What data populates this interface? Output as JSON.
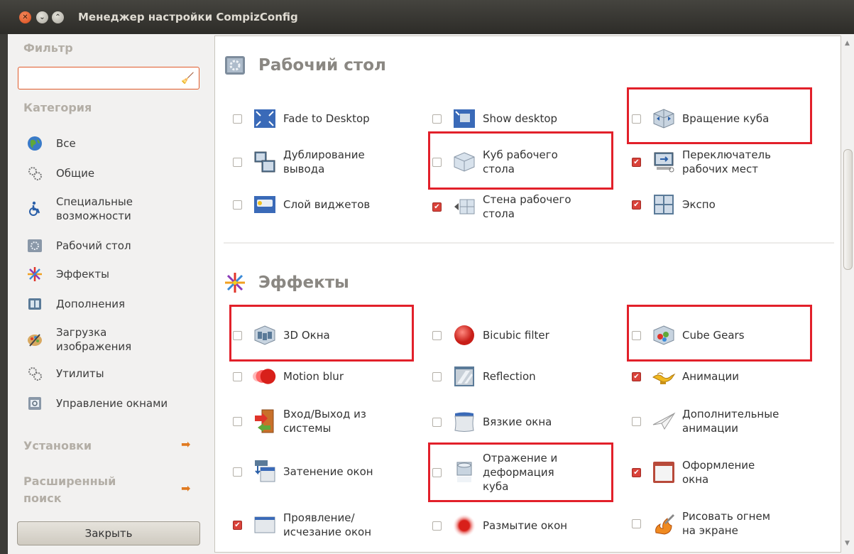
{
  "window": {
    "title": "Менеджер настройки CompizConfig"
  },
  "sidebar": {
    "filter_heading": "Фильтр",
    "filter_value": "",
    "category_heading": "Категория",
    "categories": [
      {
        "label": "Все",
        "icon": "globe-icon"
      },
      {
        "label": "Общие",
        "icon": "gears-icon"
      },
      {
        "label": "Специальные\nвозможности",
        "icon": "accessibility-icon"
      },
      {
        "label": "Рабочий стол",
        "icon": "desktop-icon"
      },
      {
        "label": "Эффекты",
        "icon": "effects-icon"
      },
      {
        "label": "Дополнения",
        "icon": "extras-icon"
      },
      {
        "label": "Загрузка\nизображения",
        "icon": "image-loading-icon"
      },
      {
        "label": "Утилиты",
        "icon": "utilities-icon"
      },
      {
        "label": "Управление окнами",
        "icon": "window-management-icon"
      }
    ],
    "settings_label": "Установки",
    "advanced_search_label": "Расширенный\nпоиск",
    "close_button": "Закрыть"
  },
  "sections": {
    "desktop": {
      "title": "Рабочий стол",
      "items": [
        {
          "label": "Fade to Desktop",
          "checked": false
        },
        {
          "label": "Show desktop",
          "checked": false
        },
        {
          "label": "Вращение куба",
          "checked": false
        },
        {
          "label": "Дублирование\nвывода",
          "checked": false
        },
        {
          "label": "Куб рабочего\nстола",
          "checked": false
        },
        {
          "label": "Переключатель\nрабочих мест",
          "checked": true
        },
        {
          "label": "Слой виджетов",
          "checked": false
        },
        {
          "label": "Стена рабочего\nстола",
          "checked": true
        },
        {
          "label": "Экспо",
          "checked": true
        }
      ]
    },
    "effects": {
      "title": "Эффекты",
      "items": [
        {
          "label": "3D Окна",
          "checked": false
        },
        {
          "label": "Bicubic filter",
          "checked": false
        },
        {
          "label": "Cube Gears",
          "checked": false
        },
        {
          "label": "Motion blur",
          "checked": false
        },
        {
          "label": "Reflection",
          "checked": false
        },
        {
          "label": "Анимации",
          "checked": true
        },
        {
          "label": "Вход/Выход из\nсистемы",
          "checked": false
        },
        {
          "label": "Вязкие окна",
          "checked": false
        },
        {
          "label": "Дополнительные\nанимации",
          "checked": false
        },
        {
          "label": "Затенение окон",
          "checked": false
        },
        {
          "label": "Отражение и\nдеформация\nкуба",
          "checked": false
        },
        {
          "label": "Оформление\nокна",
          "checked": true
        },
        {
          "label": "Проявление/\nисчезание окон",
          "checked": true
        },
        {
          "label": "Размытие окон",
          "checked": false
        },
        {
          "label": "Рисовать огнем\nна экране",
          "checked": false
        }
      ]
    }
  },
  "colors": {
    "highlight": "#e2202a",
    "checked": "#d9423a",
    "accent": "#e05a2a"
  }
}
